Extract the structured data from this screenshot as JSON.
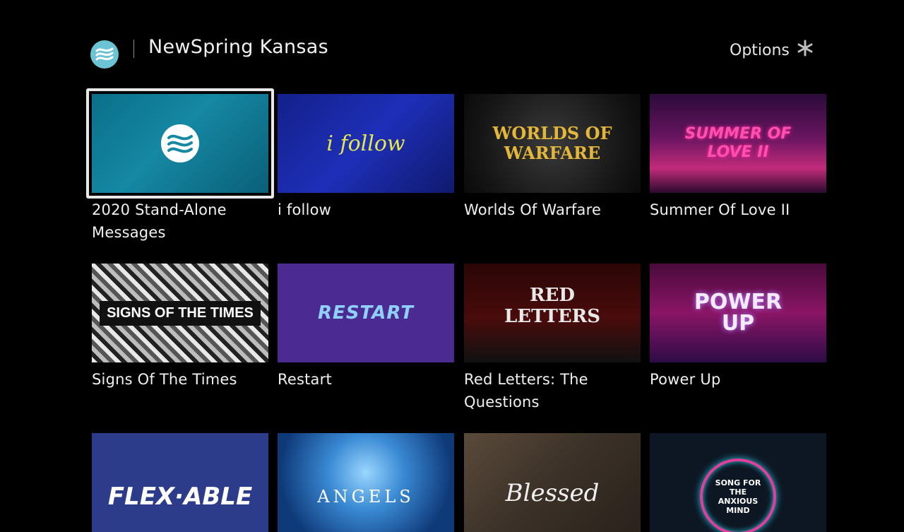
{
  "header": {
    "app_title": "NewSpring Kansas",
    "options_label": "Options",
    "logo_icon": "newspring-wave-logo-icon",
    "options_icon": "asterisk-icon"
  },
  "grid": {
    "tiles": [
      {
        "label": "2020 Stand-Alone Messages",
        "art": "2020 Stand-Alone Messages"
      },
      {
        "label": "i follow",
        "art": "i follow"
      },
      {
        "label": "Worlds Of Warfare",
        "art": "WORLDS OF WARFARE"
      },
      {
        "label": "Summer Of Love II",
        "art": "SUMMER OF LOVE II"
      },
      {
        "label": "Signs Of The Times",
        "art": "SIGNS OF THE TIMES"
      },
      {
        "label": "Restart",
        "art": "RESTART"
      },
      {
        "label": "Red Letters: The Questions",
        "art": "RED LETTERS"
      },
      {
        "label": "Power Up",
        "art": "POWER UP"
      },
      {
        "label": "",
        "art": "FLEX·ABLE"
      },
      {
        "label": "",
        "art": "ANGELS"
      },
      {
        "label": "",
        "art": "Blessed"
      },
      {
        "label": "",
        "art": "SONG FOR THE ANXIOUS MIND"
      }
    ],
    "focused_index": 0
  },
  "colors": {
    "background": "#000000",
    "logo": "#6bc3d4",
    "focus_ring": "#e8e8e8"
  }
}
